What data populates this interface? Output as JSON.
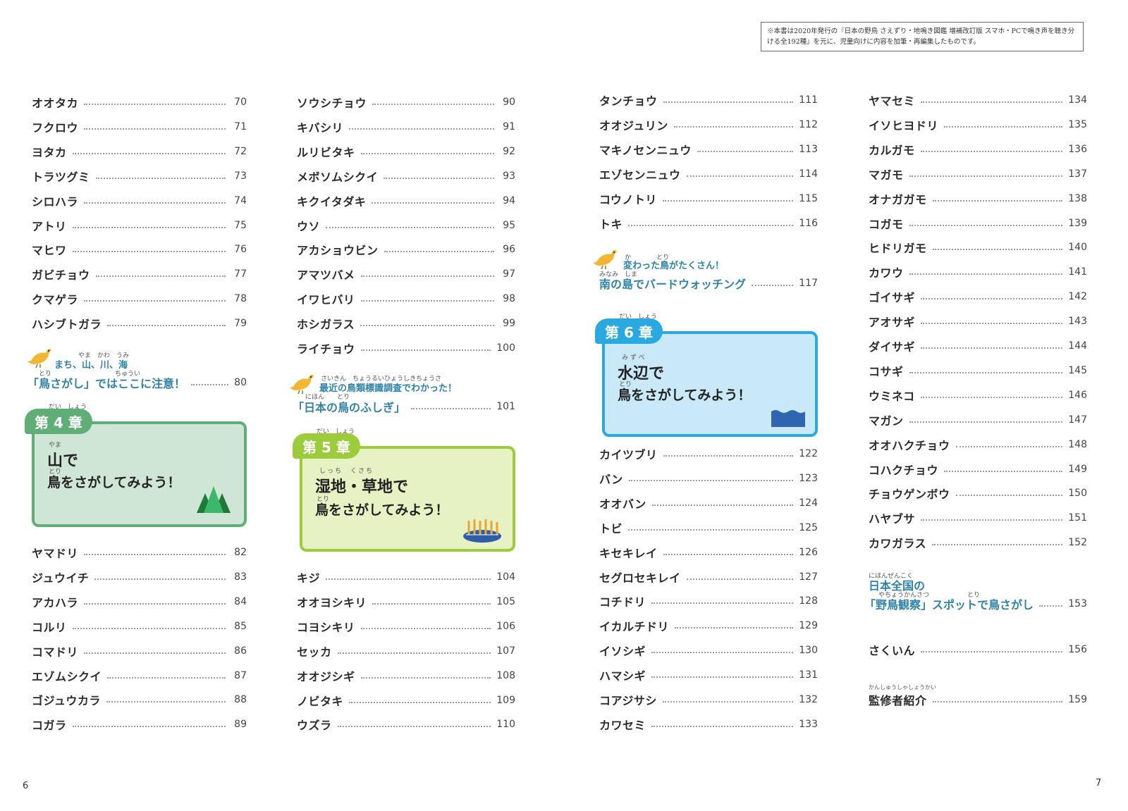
{
  "note": "※本書は2020年発行の『日本の野鳥 さえずり・地鳴き図鑑 増補改訂版 スマホ・PCで鳴き声を聴き分ける全192種』を元に、児童向けに内容を加筆・再編集したものです。",
  "col1_top": [
    {
      "name": "オオタカ",
      "page": "70"
    },
    {
      "name": "フクロウ",
      "page": "71"
    },
    {
      "name": "ヨタカ",
      "page": "72"
    },
    {
      "name": "トラツグミ",
      "page": "73"
    },
    {
      "name": "シロハラ",
      "page": "74"
    },
    {
      "name": "アトリ",
      "page": "75"
    },
    {
      "name": "マヒワ",
      "page": "76"
    },
    {
      "name": "ガビチョウ",
      "page": "77"
    },
    {
      "name": "クマゲラ",
      "page": "78"
    },
    {
      "name": "ハシブトガラ",
      "page": "79"
    }
  ],
  "topic1": {
    "line1": "まち、山、川、海",
    "line2": "「鳥さがし」ではここに注意！",
    "page": "80",
    "ruby1": "やま　かわ　うみ",
    "ruby2": "とり　　　　　　　　　　ちゅうい"
  },
  "chapter4": {
    "tab": "第 4 章",
    "tab_ruby": "だい　しょう",
    "line1": "山で",
    "line1_ruby": "やま",
    "line2": "鳥をさがしてみよう！",
    "line2_ruby": "とり"
  },
  "col1_bottom": [
    {
      "name": "ヤマドリ",
      "page": "82"
    },
    {
      "name": "ジュウイチ",
      "page": "83"
    },
    {
      "name": "アカハラ",
      "page": "84"
    },
    {
      "name": "コルリ",
      "page": "85"
    },
    {
      "name": "コマドリ",
      "page": "86"
    },
    {
      "name": "エゾムシクイ",
      "page": "87"
    },
    {
      "name": "ゴジュウカラ",
      "page": "88"
    },
    {
      "name": "コガラ",
      "page": "89"
    }
  ],
  "col2_top": [
    {
      "name": "ソウシチョウ",
      "page": "90"
    },
    {
      "name": "キバシリ",
      "page": "91"
    },
    {
      "name": "ルリビタキ",
      "page": "92"
    },
    {
      "name": "メボソムシクイ",
      "page": "93"
    },
    {
      "name": "キクイタダキ",
      "page": "94"
    },
    {
      "name": "ウソ",
      "page": "95"
    },
    {
      "name": "アカショウビン",
      "page": "96"
    },
    {
      "name": "アマツバメ",
      "page": "97"
    },
    {
      "name": "イワヒバリ",
      "page": "98"
    },
    {
      "name": "ホシガラス",
      "page": "99"
    },
    {
      "name": "ライチョウ",
      "page": "100"
    }
  ],
  "topic2": {
    "line1": "最近の鳥類標識調査でわかった！",
    "line2": "「日本の鳥のふしぎ」",
    "page": "101",
    "ruby1": "さいきん　ちょうるいひょうしきちょうさ",
    "ruby2": "にほん　　とり"
  },
  "chapter5": {
    "tab": "第 5 章",
    "tab_ruby": "だい　しょう",
    "line1": "湿地・草地で",
    "line1_ruby": "しっち　くさち",
    "line2": "鳥をさがしてみよう！",
    "line2_ruby": "とり"
  },
  "col2_bottom": [
    {
      "name": "キジ",
      "page": "104"
    },
    {
      "name": "オオヨシキリ",
      "page": "105"
    },
    {
      "name": "コヨシキリ",
      "page": "106"
    },
    {
      "name": "セッカ",
      "page": "107"
    },
    {
      "name": "オオジシギ",
      "page": "108"
    },
    {
      "name": "ノビタキ",
      "page": "109"
    },
    {
      "name": "ウズラ",
      "page": "110"
    }
  ],
  "col3_top": [
    {
      "name": "タンチョウ",
      "page": "111"
    },
    {
      "name": "オオジュリン",
      "page": "112"
    },
    {
      "name": "マキノセンニュウ",
      "page": "113"
    },
    {
      "name": "エゾセンニュウ",
      "page": "114"
    },
    {
      "name": "コウノトリ",
      "page": "115"
    },
    {
      "name": "トキ",
      "page": "116"
    }
  ],
  "topic3": {
    "line1": "変わった鳥がたくさん！",
    "line2": "南の島でバードウォッチング",
    "page": "117",
    "ruby1": "か　　　　とり",
    "ruby2": "みなみ　しま"
  },
  "chapter6": {
    "tab": "第 6 章",
    "tab_ruby": "だい　しょう",
    "line1": "水辺で",
    "line1_ruby": "みずべ",
    "line2": "鳥をさがしてみよう！",
    "line2_ruby": "とり"
  },
  "col3_bottom": [
    {
      "name": "カイツブリ",
      "page": "122"
    },
    {
      "name": "バン",
      "page": "123"
    },
    {
      "name": "オオバン",
      "page": "124"
    },
    {
      "name": "トビ",
      "page": "125"
    },
    {
      "name": "キセキレイ",
      "page": "126"
    },
    {
      "name": "セグロセキレイ",
      "page": "127"
    },
    {
      "name": "コチドリ",
      "page": "128"
    },
    {
      "name": "イカルチドリ",
      "page": "129"
    },
    {
      "name": "イソシギ",
      "page": "130"
    },
    {
      "name": "ハマシギ",
      "page": "131"
    },
    {
      "name": "コアジサシ",
      "page": "132"
    },
    {
      "name": "カワセミ",
      "page": "133"
    }
  ],
  "col4": [
    {
      "name": "ヤマセミ",
      "page": "134"
    },
    {
      "name": "イソヒヨドリ",
      "page": "135"
    },
    {
      "name": "カルガモ",
      "page": "136"
    },
    {
      "name": "マガモ",
      "page": "137"
    },
    {
      "name": "オナガガモ",
      "page": "138"
    },
    {
      "name": "コガモ",
      "page": "139"
    },
    {
      "name": "ヒドリガモ",
      "page": "140"
    },
    {
      "name": "カワウ",
      "page": "141"
    },
    {
      "name": "ゴイサギ",
      "page": "142"
    },
    {
      "name": "アオサギ",
      "page": "143"
    },
    {
      "name": "ダイサギ",
      "page": "144"
    },
    {
      "name": "コサギ",
      "page": "145"
    },
    {
      "name": "ウミネコ",
      "page": "146"
    },
    {
      "name": "マガン",
      "page": "147"
    },
    {
      "name": "オオハクチョウ",
      "page": "148"
    },
    {
      "name": "コハクチョウ",
      "page": "149"
    },
    {
      "name": "チョウゲンボウ",
      "page": "150"
    },
    {
      "name": "ハヤブサ",
      "page": "151"
    },
    {
      "name": "カワガラス",
      "page": "152"
    }
  ],
  "topic4": {
    "line1": "日本全国の",
    "line2": "「野鳥観察」スポットで鳥さがし",
    "page": "153",
    "ruby1": "にほんぜんこく",
    "ruby2": "やちょうかんさつ　　　　　　とり"
  },
  "index": {
    "name": "さくいん",
    "page": "156"
  },
  "supervisor": {
    "name": "監修者紹介",
    "page": "159",
    "ruby": "かんしゅうしゃしょうかい"
  },
  "page_left": "6",
  "page_right": "7",
  "colors": {
    "accent_blue": "#2f83a8",
    "ch4": "#5fae78",
    "ch5": "#9ccb3c",
    "ch6": "#2aa9e0"
  }
}
